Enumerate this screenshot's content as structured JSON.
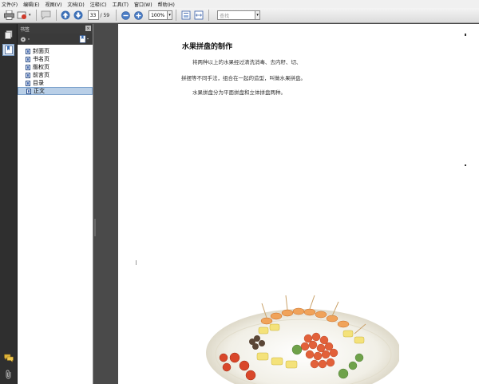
{
  "menu": [
    "文件(F)",
    "编辑(E)",
    "视图(V)",
    "文档(D)",
    "注释(C)",
    "工具(T)",
    "窗口(W)",
    "帮助(H)"
  ],
  "toolbar": {
    "current_page": "33",
    "total_pages": "/ 59",
    "zoom": "100%",
    "find_placeholder": "查找"
  },
  "panel": {
    "title": "书签",
    "bookmarks": [
      {
        "label": "封面页",
        "selected": false
      },
      {
        "label": "书名页",
        "selected": false
      },
      {
        "label": "版权页",
        "selected": false
      },
      {
        "label": "前言页",
        "selected": false
      },
      {
        "label": "目录",
        "selected": false
      },
      {
        "label": "正文",
        "selected": true
      }
    ]
  },
  "document": {
    "title": "水果拼盘的制作",
    "paragraphs": [
      "将两种以上的水果经过清洗消毒、去内籽、切、",
      "拼摆等不同手法，组合在一起的造型，叫做水果拼盘。",
      "水果拼盘分为平面拼盘和立体拼盘两种。"
    ]
  },
  "colors": {
    "accent": "#3b6fb6",
    "panel_dark": "#3c3c3c",
    "selected_bg": "#b9cfe7"
  }
}
